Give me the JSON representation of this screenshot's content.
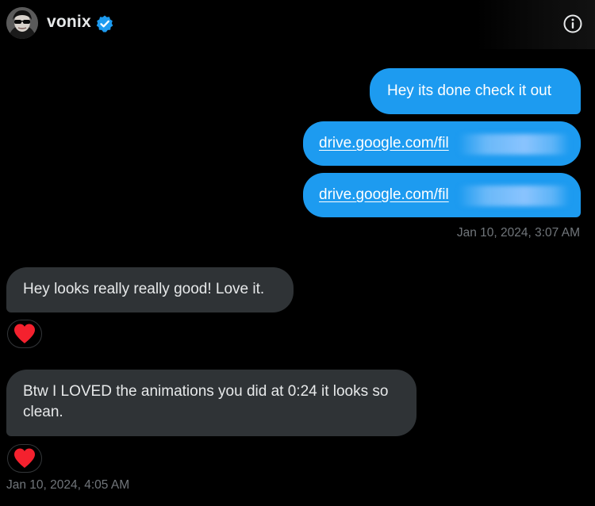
{
  "header": {
    "username": "vonix",
    "verified": true,
    "avatar_icon": "avatar-icon",
    "info_icon": "info-icon"
  },
  "messages": [
    {
      "direction": "sent",
      "text": "Hey its done check it out"
    },
    {
      "direction": "sent",
      "type": "link",
      "text": "drive.google.com/fil"
    },
    {
      "direction": "sent",
      "type": "link",
      "text": "drive.google.com/fil"
    },
    {
      "direction": "sent",
      "type": "timestamp",
      "text": "Jan 10, 2024, 3:07 AM"
    },
    {
      "direction": "received",
      "text": "Hey looks really really good! Love it.",
      "reaction": "heart-icon"
    },
    {
      "direction": "received",
      "text": "Btw I LOVED the animations you did at 0:24 it looks so clean.",
      "reaction": "heart-icon"
    },
    {
      "direction": "received",
      "type": "timestamp",
      "text": "Jan 10, 2024, 4:05 AM"
    }
  ],
  "colors": {
    "background": "#000000",
    "sent_bubble": "#1d9bf0",
    "received_bubble": "#2f3336",
    "timestamp": "#71767b",
    "heart": "#f91880",
    "verified_badge": "#1d9bf0"
  }
}
